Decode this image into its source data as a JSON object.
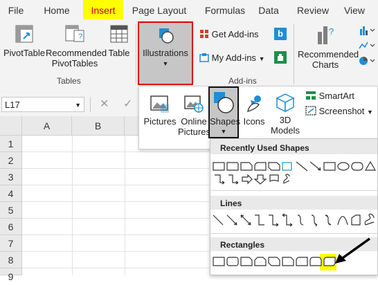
{
  "tabs": [
    "File",
    "Home",
    "Insert",
    "Page Layout",
    "Formulas",
    "Data",
    "Review",
    "View"
  ],
  "ribbon": {
    "pivottable": "PivotTable",
    "recommended_pivot": "Recommended PivotTables",
    "table": "Table",
    "tables_group": "Tables",
    "illustrations": "Illustrations",
    "get_addins": "Get Add-ins",
    "my_addins": "My Add-ins",
    "addins_group": "Add-ins",
    "recommended_charts": "Recommended Charts"
  },
  "formula_bar": {
    "name_box": "L17"
  },
  "columns": [
    "A",
    "B"
  ],
  "rows": [
    "1",
    "2",
    "3",
    "4",
    "5",
    "6",
    "7",
    "8",
    "9"
  ],
  "illustrations_menu": {
    "pictures": "Pictures",
    "online_pictures": "Online Pictures",
    "shapes": "Shapes",
    "icons": "Icons",
    "models_3d": "3D Models",
    "smartart": "SmartArt",
    "screenshot": "Screenshot"
  },
  "shapes_gallery": {
    "recent": "Recently Used Shapes",
    "lines": "Lines",
    "rectangles": "Rectangles"
  },
  "colors": {
    "highlight": "#ffff00",
    "red_outline": "#e00000",
    "accent": "#1e8fd6"
  }
}
